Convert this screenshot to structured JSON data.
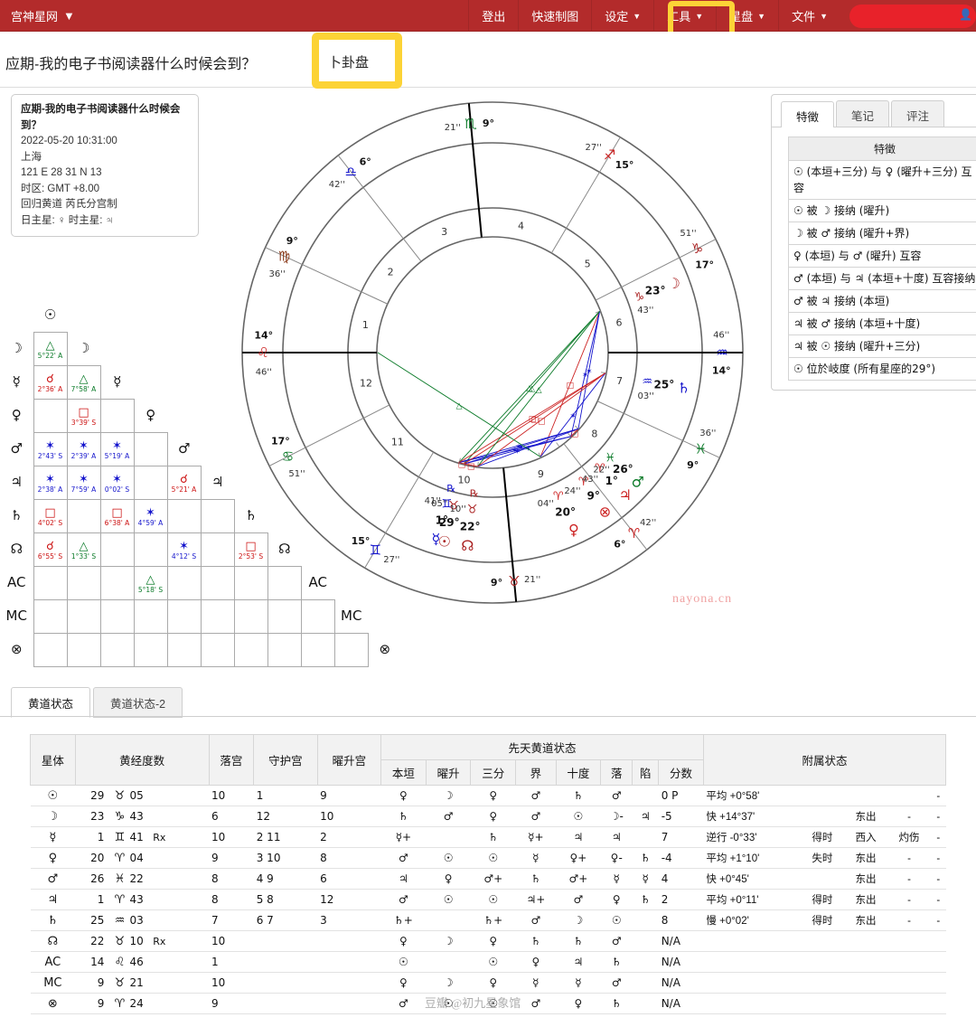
{
  "nav": {
    "brand": "宫神星网",
    "caret": "▼",
    "items": [
      {
        "label": "登出",
        "has_caret": false
      },
      {
        "label": "快速制图",
        "has_caret": false
      },
      {
        "label": "设定",
        "has_caret": true
      },
      {
        "label": "工具",
        "has_caret": true
      },
      {
        "label": "星盘",
        "has_caret": true
      },
      {
        "label": "文件",
        "has_caret": true
      }
    ],
    "highlight_color": "#fcd336",
    "bar_color": "#b32b2b"
  },
  "header": {
    "page_title": "应期-我的电子书阅读器什么时候会到？",
    "chart_type": "卜卦盘"
  },
  "infobox": {
    "title": "应期-我的电子书阅读器什么时候会到？",
    "datetime": "2022-05-20 10:31:00",
    "place": "上海",
    "coords": "121 E 28  31 N 13",
    "timezone": "时区: GMT +8.00",
    "zodiac": "回归黄道 芮氏分宫制",
    "rulers": "日主星: ♀ 时主星: ♃"
  },
  "aspect_grid": {
    "planets": [
      "☉",
      "☽",
      "☿",
      "♀",
      "♂",
      "♃",
      "♄",
      "☊",
      "AC",
      "MC",
      "⊗"
    ],
    "cells": [
      {
        "row": 1,
        "col": 0,
        "sym": "△",
        "orb": "5°22' A",
        "color": "green"
      },
      {
        "row": 2,
        "col": 0,
        "sym": "☌",
        "orb": "2°36' A",
        "color": "red"
      },
      {
        "row": 2,
        "col": 1,
        "sym": "△",
        "orb": "7°58' A",
        "color": "green"
      },
      {
        "row": 3,
        "col": 1,
        "sym": "□",
        "orb": "3°39' S",
        "color": "red"
      },
      {
        "row": 4,
        "col": 0,
        "sym": "✶",
        "orb": "2°43' S",
        "color": "blue"
      },
      {
        "row": 4,
        "col": 1,
        "sym": "✶",
        "orb": "2°39' A",
        "color": "blue"
      },
      {
        "row": 4,
        "col": 2,
        "sym": "✶",
        "orb": "5°19' A",
        "color": "blue"
      },
      {
        "row": 5,
        "col": 0,
        "sym": "✶",
        "orb": "2°38' A",
        "color": "blue"
      },
      {
        "row": 5,
        "col": 1,
        "sym": "✶",
        "orb": "7°59' A",
        "color": "blue"
      },
      {
        "row": 5,
        "col": 2,
        "sym": "✶",
        "orb": "0°02' S",
        "color": "blue"
      },
      {
        "row": 5,
        "col": 4,
        "sym": "☌",
        "orb": "5°21' A",
        "color": "red"
      },
      {
        "row": 6,
        "col": 0,
        "sym": "□",
        "orb": "4°02' S",
        "color": "red"
      },
      {
        "row": 6,
        "col": 2,
        "sym": "□",
        "orb": "6°38' A",
        "color": "red"
      },
      {
        "row": 6,
        "col": 3,
        "sym": "✶",
        "orb": "4°59' A",
        "color": "blue"
      },
      {
        "row": 7,
        "col": 0,
        "sym": "☌",
        "orb": "6°55' S",
        "color": "red"
      },
      {
        "row": 7,
        "col": 1,
        "sym": "△",
        "orb": "1°33' S",
        "color": "green"
      },
      {
        "row": 7,
        "col": 4,
        "sym": "✶",
        "orb": "4°12' S",
        "color": "blue"
      },
      {
        "row": 7,
        "col": 6,
        "sym": "□",
        "orb": "2°53' S",
        "color": "red"
      },
      {
        "row": 8,
        "col": 3,
        "sym": "△",
        "orb": "5°18' S",
        "color": "green"
      }
    ]
  },
  "wheel": {
    "watermark": "nayona.cn",
    "house_numbers": [
      "1",
      "2",
      "3",
      "4",
      "5",
      "6",
      "7",
      "8",
      "9",
      "10",
      "11",
      "12"
    ],
    "cusps": [
      {
        "house": 1,
        "deg": "14°",
        "sign": "♌",
        "min": "46'"
      },
      {
        "house": 2,
        "deg": "9°",
        "sign": "♍",
        "min": "36'"
      },
      {
        "house": 3,
        "deg": "6°",
        "sign": "♎",
        "min": "42'"
      },
      {
        "house": 4,
        "deg": "9°",
        "sign": "♏",
        "min": "21'"
      },
      {
        "house": 5,
        "deg": "15°",
        "sign": "♐",
        "min": "27'"
      },
      {
        "house": 6,
        "deg": "17°",
        "sign": "♑",
        "min": "51'"
      },
      {
        "house": 7,
        "deg": "14°",
        "sign": "♒",
        "min": "46'"
      },
      {
        "house": 8,
        "deg": "9°",
        "sign": "♓",
        "min": "36'"
      },
      {
        "house": 9,
        "deg": "6°",
        "sign": "♈",
        "min": "42'"
      },
      {
        "house": 10,
        "deg": "9°",
        "sign": "♉",
        "min": "21'"
      },
      {
        "house": 11,
        "deg": "15°",
        "sign": "♊",
        "min": "27'"
      },
      {
        "house": 12,
        "deg": "17°",
        "sign": "♋",
        "min": "51'"
      }
    ],
    "planets": [
      {
        "name": "☿",
        "deg": "1°",
        "sign": "♊",
        "min": "41'",
        "retro": "℞",
        "color": "#1414cc"
      },
      {
        "name": "☉",
        "deg": "29°",
        "sign": "♉",
        "min": "05'",
        "retro": "",
        "color": "#aa2222"
      },
      {
        "name": "☊",
        "deg": "22°",
        "sign": "♉",
        "min": "10'",
        "retro": "℞",
        "color": "#aa2222"
      },
      {
        "name": "♀",
        "deg": "20°",
        "sign": "♈",
        "min": "04'",
        "retro": "",
        "color": "#cc2222"
      },
      {
        "name": "⊗",
        "deg": "9°",
        "sign": "♈",
        "min": "24'",
        "retro": "",
        "color": "#cc2222"
      },
      {
        "name": "♃",
        "deg": "1°",
        "sign": "♈",
        "min": "43'",
        "retro": "",
        "color": "#cc2222"
      },
      {
        "name": "♂",
        "deg": "26°",
        "sign": "♓",
        "min": "22'",
        "retro": "",
        "color": "#0a7a28"
      },
      {
        "name": "♄",
        "deg": "25°",
        "sign": "♒",
        "min": "03'",
        "retro": "",
        "color": "#1414cc"
      },
      {
        "name": "☽",
        "deg": "23°",
        "sign": "♑",
        "min": "43'",
        "retro": "",
        "color": "#aa2222"
      }
    ]
  },
  "features_panel": {
    "tabs": [
      {
        "label": "特徵",
        "active": true
      },
      {
        "label": "笔记",
        "active": false
      },
      {
        "label": "评注",
        "active": false
      }
    ],
    "table_header": "特徵",
    "rows": [
      "☉ (本垣+三分) 与 ♀ (曜升+三分) 互容",
      "☉ 被 ☽ 接纳 (曜升)",
      "☽ 被 ♂ 接纳 (曜升+界)",
      "♀ (本垣) 与 ♂ (曜升) 互容",
      "♂ (本垣) 与 ♃ (本垣+十度) 互容接纳",
      "♂ 被 ♃ 接纳 (本垣)",
      "♃ 被 ♂ 接纳 (本垣+十度)",
      "♃ 被 ☉ 接纳 (曜升+三分)",
      "☉ 位於岐度 (所有星座的29°)"
    ]
  },
  "bottom_tabs": [
    {
      "label": "黄道状态",
      "active": true
    },
    {
      "label": "黄道状态-2",
      "active": false
    }
  ],
  "dignity_table": {
    "group_headers": [
      {
        "label": "先天黄道状态",
        "span": 8
      },
      {
        "label": "附属状态",
        "span": 5
      }
    ],
    "headers": {
      "body": "星体",
      "longitude": "黄经度数",
      "house": "落宫",
      "rules": "守护宫",
      "exalt_house": "曜升宫",
      "domicile": "本垣",
      "exaltation": "曜升",
      "triplicity": "三分",
      "term": "界",
      "face": "十度",
      "fall": "落",
      "detriment": "陷",
      "score": "分数"
    },
    "rows": [
      {
        "body": "☉",
        "deg": "29",
        "sign": "♉",
        "min": "05",
        "rx": "",
        "house": "10",
        "rules": "1",
        "exalt_house": "9",
        "domicile": "♀",
        "exaltation": "☽",
        "triplicity": "♀",
        "term": "♂",
        "face": "♄",
        "fall": "♂",
        "detriment": "",
        "score": "0 P",
        "speed_label": "平均",
        "speed": "+0°58'",
        "a1": "",
        "a2": "",
        "a3": "",
        "a4": "-"
      },
      {
        "body": "☽",
        "deg": "23",
        "sign": "♑",
        "min": "43",
        "rx": "",
        "house": "6",
        "rules": "12",
        "exalt_house": "10",
        "domicile": "♄",
        "exaltation": "♂",
        "triplicity": "♀",
        "term": "♂",
        "face": "☉",
        "fall": "☽-",
        "detriment": "♃",
        "score": "-5",
        "speed_label": "快",
        "speed": "+14°37'",
        "a1": "",
        "a2": "东出",
        "a3": "-",
        "a4": "-"
      },
      {
        "body": "☿",
        "deg": "1",
        "sign": "♊",
        "min": "41",
        "rx": "Rx",
        "house": "10",
        "rules": "2 11",
        "exalt_house": "2",
        "domicile": "☿+",
        "exaltation": "",
        "triplicity": "♄",
        "term": "☿+",
        "face": "♃",
        "fall": "♃",
        "detriment": "",
        "score": "7",
        "speed_label": "逆行",
        "speed": "-0°33'",
        "a1": "得时",
        "a2": "西入",
        "a3": "灼伤",
        "a4": "-"
      },
      {
        "body": "♀",
        "deg": "20",
        "sign": "♈",
        "min": "04",
        "rx": "",
        "house": "9",
        "rules": "3 10",
        "exalt_house": "8",
        "domicile": "♂",
        "exaltation": "☉",
        "triplicity": "☉",
        "term": "☿",
        "face": "♀+",
        "fall": "♀-",
        "detriment": "♄",
        "score": "-4",
        "speed_label": "平均",
        "speed": "+1°10'",
        "a1": "失时",
        "a2": "东出",
        "a3": "-",
        "a4": "-"
      },
      {
        "body": "♂",
        "deg": "26",
        "sign": "♓",
        "min": "22",
        "rx": "",
        "house": "8",
        "rules": "4 9",
        "exalt_house": "6",
        "domicile": "♃",
        "exaltation": "♀",
        "triplicity": "♂+",
        "term": "♄",
        "face": "♂+",
        "fall": "☿",
        "detriment": "☿",
        "score": "4",
        "speed_label": "快",
        "speed": "+0°45'",
        "a1": "",
        "a2": "东出",
        "a3": "-",
        "a4": "-"
      },
      {
        "body": "♃",
        "deg": "1",
        "sign": "♈",
        "min": "43",
        "rx": "",
        "house": "8",
        "rules": "5 8",
        "exalt_house": "12",
        "domicile": "♂",
        "exaltation": "☉",
        "triplicity": "☉",
        "term": "♃+",
        "face": "♂",
        "fall": "♀",
        "detriment": "♄",
        "score": "2",
        "speed_label": "平均",
        "speed": "+0°11'",
        "a1": "得时",
        "a2": "东出",
        "a3": "-",
        "a4": "-"
      },
      {
        "body": "♄",
        "deg": "25",
        "sign": "♒",
        "min": "03",
        "rx": "",
        "house": "7",
        "rules": "6 7",
        "exalt_house": "3",
        "domicile": "♄+",
        "exaltation": "",
        "triplicity": "♄+",
        "term": "♂",
        "face": "☽",
        "fall": "☉",
        "detriment": "",
        "score": "8",
        "speed_label": "慢",
        "speed": "+0°02'",
        "a1": "得时",
        "a2": "东出",
        "a3": "-",
        "a4": "-"
      },
      {
        "body": "☊",
        "deg": "22",
        "sign": "♉",
        "min": "10",
        "rx": "Rx",
        "house": "10",
        "rules": "",
        "exalt_house": "",
        "domicile": "♀",
        "exaltation": "☽",
        "triplicity": "♀",
        "term": "♄",
        "face": "♄",
        "fall": "♂",
        "detriment": "",
        "score": "N/A",
        "speed_label": "",
        "speed": "",
        "a1": "",
        "a2": "",
        "a3": "",
        "a4": ""
      },
      {
        "body": "AC",
        "deg": "14",
        "sign": "♌",
        "min": "46",
        "rx": "",
        "house": "1",
        "rules": "",
        "exalt_house": "",
        "domicile": "☉",
        "exaltation": "",
        "triplicity": "☉",
        "term": "♀",
        "face": "♃",
        "fall": "♄",
        "detriment": "",
        "score": "N/A",
        "speed_label": "",
        "speed": "",
        "a1": "",
        "a2": "",
        "a3": "",
        "a4": ""
      },
      {
        "body": "MC",
        "deg": "9",
        "sign": "♉",
        "min": "21",
        "rx": "",
        "house": "10",
        "rules": "",
        "exalt_house": "",
        "domicile": "♀",
        "exaltation": "☽",
        "triplicity": "♀",
        "term": "☿",
        "face": "☿",
        "fall": "♂",
        "detriment": "",
        "score": "N/A",
        "speed_label": "",
        "speed": "",
        "a1": "",
        "a2": "",
        "a3": "",
        "a4": ""
      },
      {
        "body": "⊗",
        "deg": "9",
        "sign": "♈",
        "min": "24",
        "rx": "",
        "house": "9",
        "rules": "",
        "exalt_house": "",
        "domicile": "♂",
        "exaltation": "☉",
        "triplicity": "☉",
        "term": "♂",
        "face": "♀",
        "fall": "♄",
        "detriment": "",
        "score": "N/A",
        "speed_label": "",
        "speed": "",
        "a1": "",
        "a2": "",
        "a3": "",
        "a4": ""
      }
    ]
  },
  "watermark_bottom": "豆瓣 @初九星象馆"
}
